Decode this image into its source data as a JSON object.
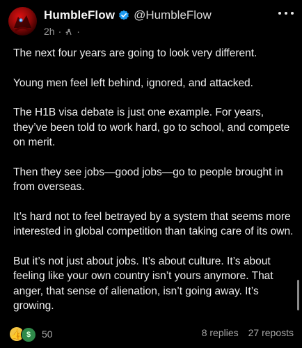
{
  "post": {
    "author": {
      "display_name": "HumbleFlow",
      "handle": "@HumbleFlow",
      "verified_icon": "verified-badge-icon",
      "avatar_icon": "avatar-image"
    },
    "meta": {
      "time": "2h",
      "separator": "·",
      "trailing_separator": "·"
    },
    "more_icon": "more-options-icon",
    "paragraphs": [
      "The next four years are going to look very different.",
      "Young men feel left behind, ignored, and attacked.",
      "The H1B visa debate is just one example. For years, they’ve been told to work hard, go to school, and compete on merit.",
      "Then they see jobs—good jobs—go to people brought in from overseas.",
      "It’s hard not to feel betrayed by a system that seems more interested in global competition than taking care of its own.",
      "But it’s not just about jobs. It’s about culture. It’s about feeling like your own country isn’t yours anymore. That anger, that sense of alienation, isn’t going away. It’s growing."
    ],
    "footer": {
      "reaction_icons": [
        "thumbs-up-icon",
        "money-face-icon"
      ],
      "reaction_count": "50",
      "replies": "8 replies",
      "reposts": "27 reposts"
    }
  },
  "colors": {
    "background": "#000000",
    "text": "#efefef",
    "muted": "#9a9a9a",
    "verified": "#1d9bf0"
  }
}
